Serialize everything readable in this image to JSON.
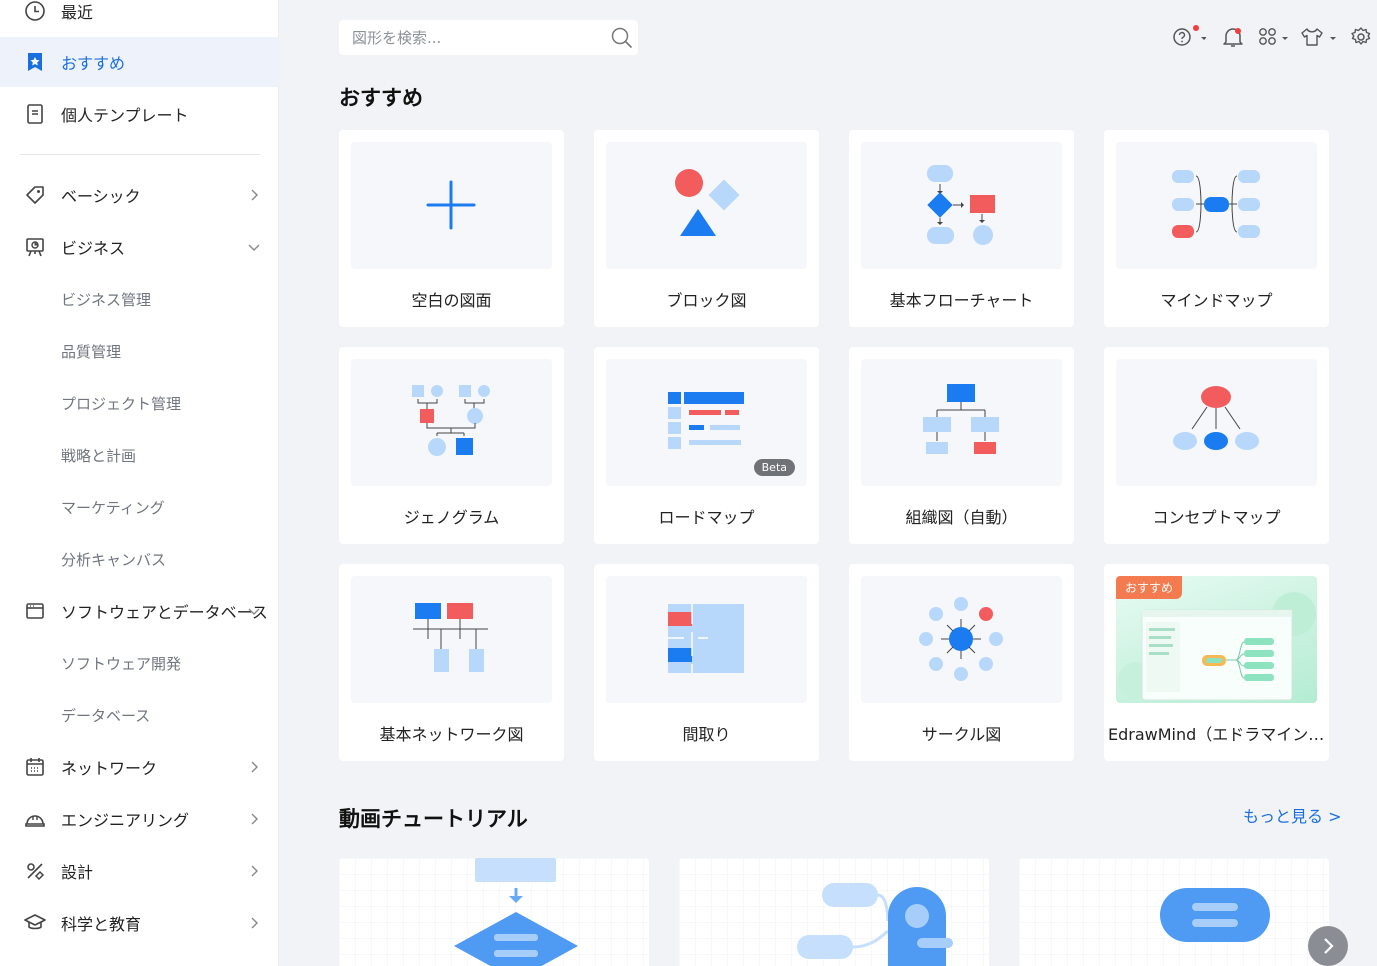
{
  "sidebar": {
    "items": [
      {
        "label": "最近",
        "icon": "clock-icon"
      },
      {
        "label": "おすすめ",
        "icon": "star-bookmark-icon"
      },
      {
        "label": "個人テンプレート",
        "icon": "document-icon"
      },
      {
        "label": "ベーシック",
        "icon": "tag-icon"
      },
      {
        "label": "ビジネス",
        "icon": "presentation-icon"
      },
      {
        "label": "ソフトウェアとデータベース",
        "icon": "window-icon"
      },
      {
        "label": "ネットワーク",
        "icon": "calendar-icon"
      },
      {
        "label": "エンジニアリング",
        "icon": "helmet-icon"
      },
      {
        "label": "設計",
        "icon": "design-tools-icon"
      },
      {
        "label": "科学と教育",
        "icon": "graduation-cap-icon"
      }
    ],
    "business_sub": [
      "ビジネス管理",
      "品質管理",
      "プロジェクト管理",
      "戦略と計画",
      "マーケティング",
      "分析キャンバス"
    ],
    "software_sub": [
      "ソフトウェア開発",
      "データベース"
    ],
    "active_color": "#1a6fe0"
  },
  "search": {
    "placeholder": "図形を検索..."
  },
  "main": {
    "recommended_title": "おすすめ",
    "tutorial_title": "動画チュートリアル",
    "more_link": "もっと見る >",
    "cards": [
      {
        "label": "空白の図面"
      },
      {
        "label": "ブロック図"
      },
      {
        "label": "基本フローチャート"
      },
      {
        "label": "マインドマップ"
      },
      {
        "label": "ジェノグラム"
      },
      {
        "label": "ロードマップ",
        "badge": "Beta"
      },
      {
        "label": "組織図（自動）"
      },
      {
        "label": "コンセプトマップ"
      },
      {
        "label": "基本ネットワーク図"
      },
      {
        "label": "間取り"
      },
      {
        "label": "サークル図"
      },
      {
        "label": "EdrawMind（エドラマインド）",
        "badge": "おすすめ"
      }
    ]
  },
  "colors": {
    "blue": "#1a7cf0",
    "light_blue": "#b8d8fb",
    "red": "#f25c5c",
    "accent": "#1a6fe0"
  }
}
